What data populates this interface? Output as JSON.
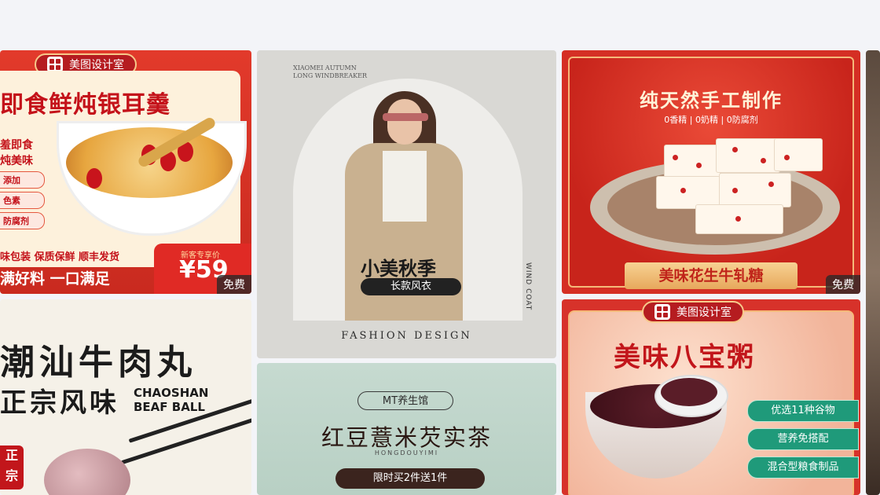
{
  "badges": {
    "free": "免费",
    "brand": "美图设计室"
  },
  "card1": {
    "title": "即食鲜炖银耳羹",
    "side_heading_1": "羞即食",
    "side_heading_2": "炖美味",
    "side_pills": [
      "添加",
      "色素",
      "防腐剂"
    ],
    "tagline": "味包装 保质保鲜 顺丰发货",
    "bottom": "满好料 一口满足",
    "price_label": "新客专享价",
    "price": "¥59"
  },
  "card2": {
    "en_small_1": "XIAOMEI AUTUMN",
    "en_small_2": "LONG WINDBREAKER",
    "title": "小美秋季",
    "subtitle": "长款风衣",
    "vertical": "WIND COAT",
    "footer": "FASHION DESIGN"
  },
  "card3": {
    "title": "纯天然手工制作",
    "subtitle": "0香精 | 0奶精 | 0防腐剂",
    "banner": "美味花生牛轧糖"
  },
  "card4": {
    "title": "美味八宝粥",
    "tags": [
      "优选11种谷物",
      "营养免搭配",
      "混合型粮食制品"
    ]
  },
  "card5": {
    "title_1": "潮汕牛肉丸",
    "title_2": "正宗风味",
    "en_1": "CHAOSHAN",
    "en_2": "BEAF BALL",
    "seal": "正宗"
  },
  "card6": {
    "brand": "MT养生馆",
    "title": "红豆薏米芡实茶",
    "pinyin": "HONGDOUYIMI",
    "promo": "限时买2件送1件"
  },
  "colors": {
    "red": "#d52f24",
    "gold": "#f5b97a",
    "green": "#1f9a7a"
  }
}
